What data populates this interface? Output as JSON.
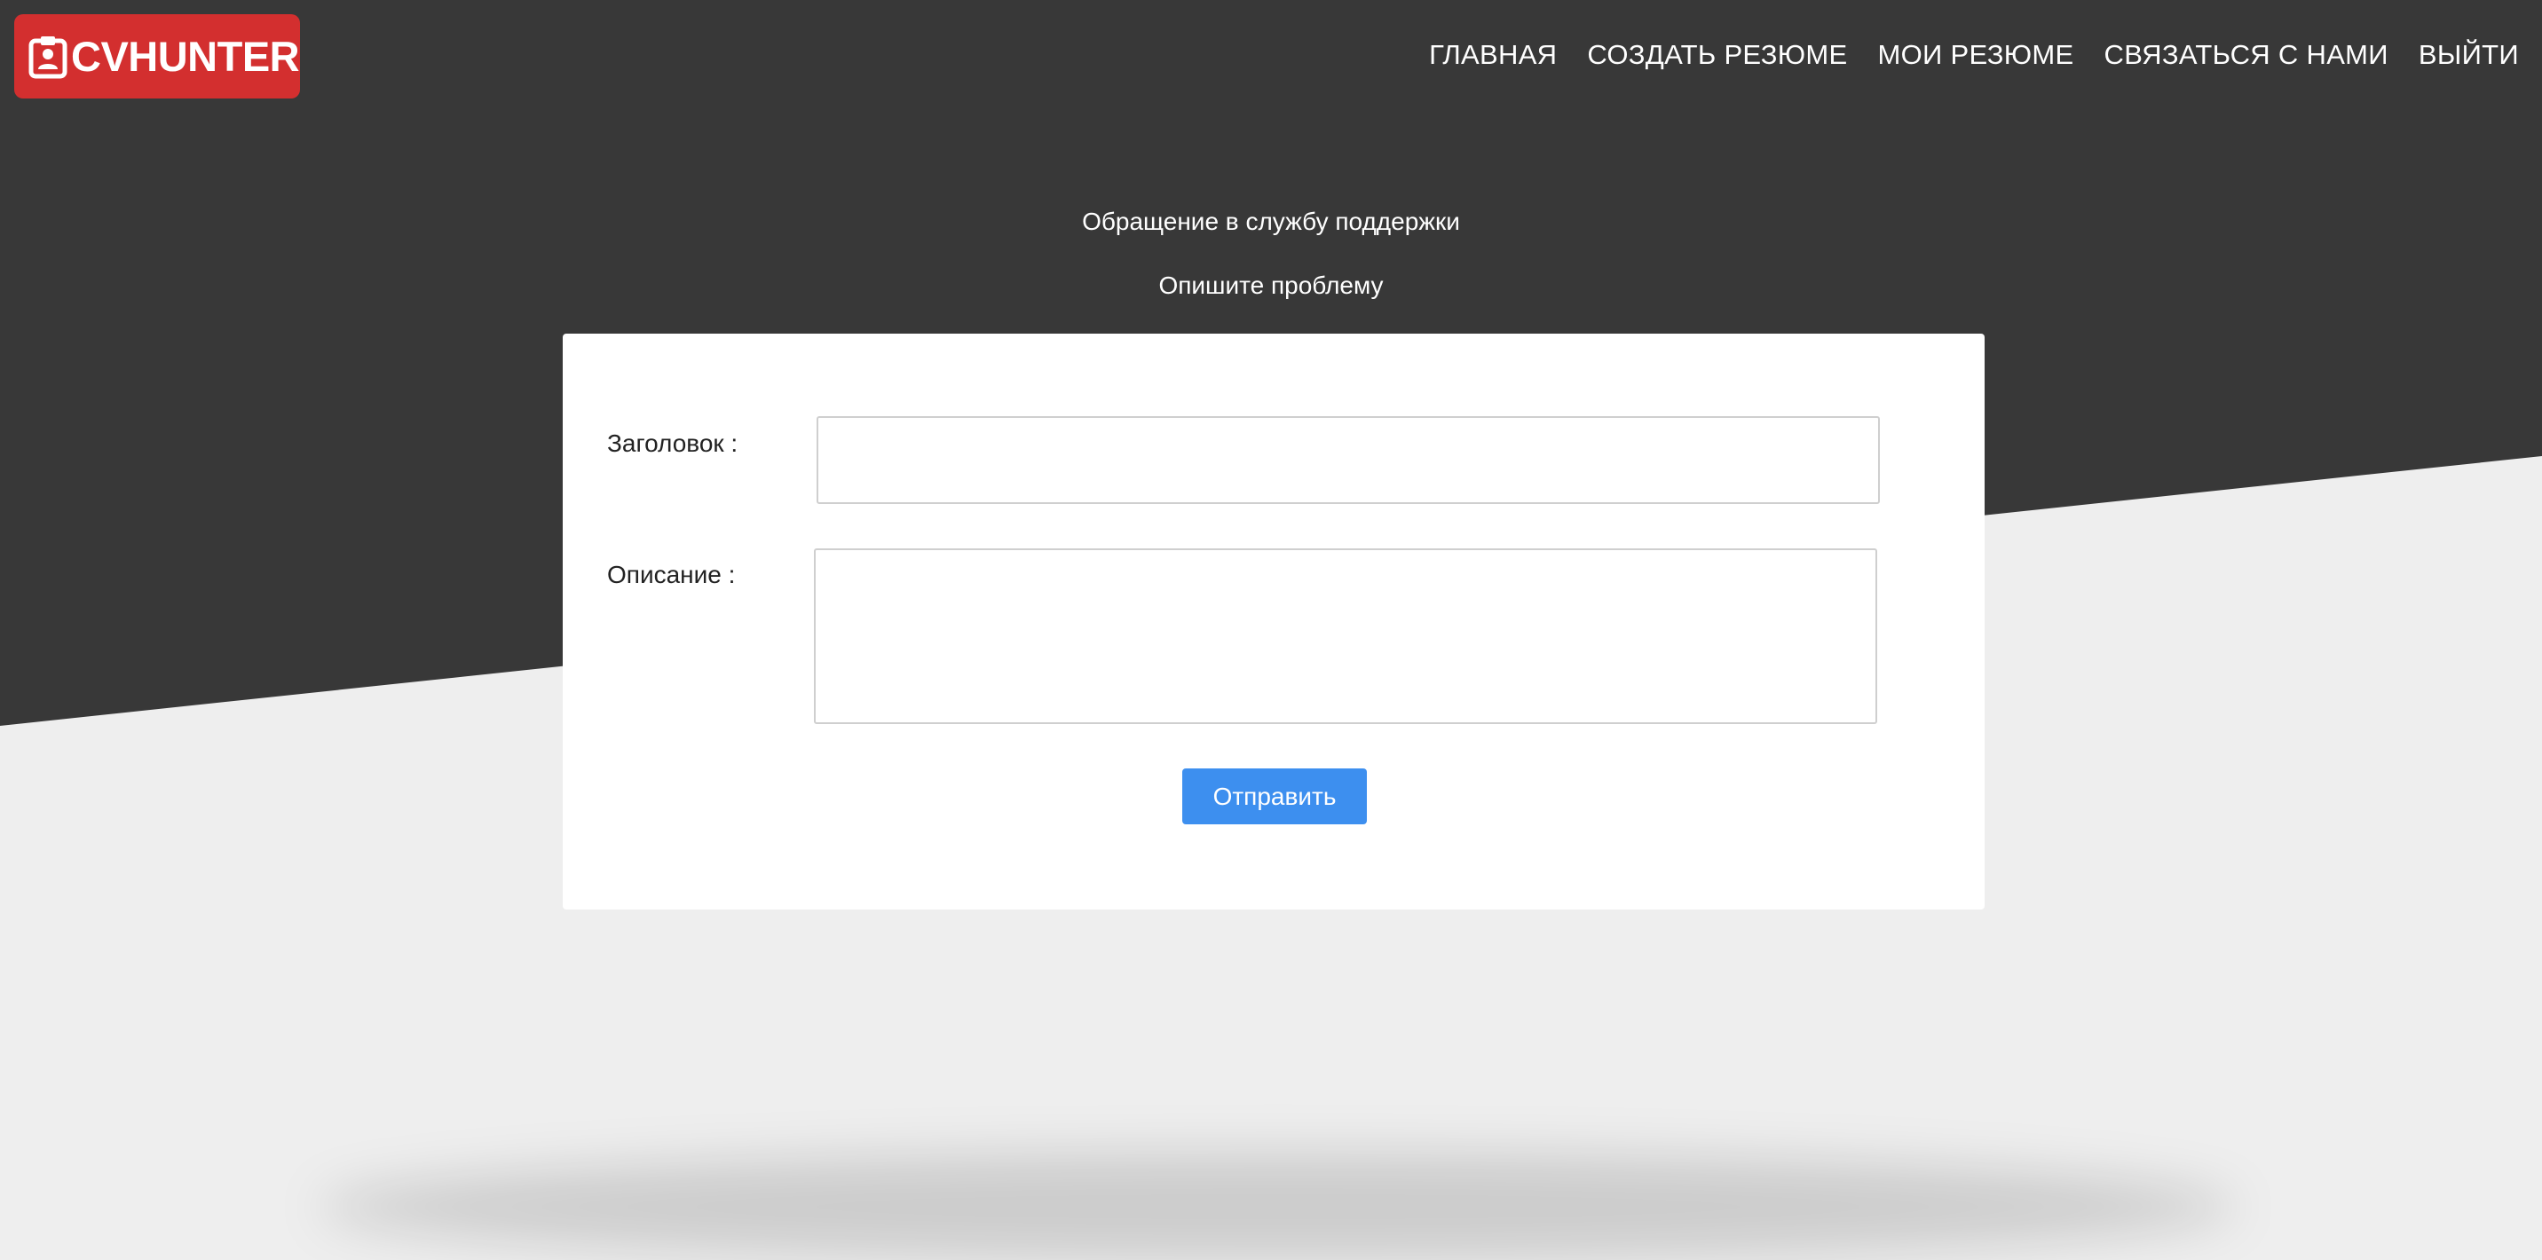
{
  "header": {
    "logo_text": "CVHUNTER",
    "logo_icon": "id-badge-icon",
    "brand_color": "#d32f2f",
    "nav": [
      {
        "label": "ГЛАВНАЯ"
      },
      {
        "label": "СОЗДАТЬ РЕЗЮМЕ"
      },
      {
        "label": "МОИ РЕЗЮМЕ"
      },
      {
        "label": "СВЯЗАТЬСЯ С НАМИ"
      },
      {
        "label": "ВЫЙТИ"
      }
    ]
  },
  "page": {
    "heading": "Обращение в службу поддержки",
    "subheading": "Опишите проблему"
  },
  "form": {
    "title_label": "Заголовок :",
    "title_value": "",
    "description_label": "Описание :",
    "description_value": "",
    "submit_label": "Отправить",
    "submit_color": "#3d8fef"
  }
}
